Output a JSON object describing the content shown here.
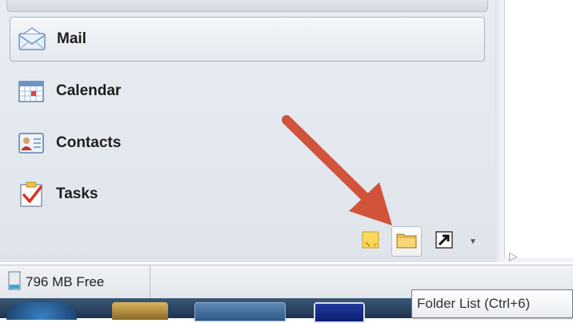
{
  "navigation": {
    "items": [
      {
        "label": "Mail",
        "icon": "mail-icon",
        "selected": true
      },
      {
        "label": "Calendar",
        "icon": "calendar-icon",
        "selected": false
      },
      {
        "label": "Contacts",
        "icon": "contacts-icon",
        "selected": false
      },
      {
        "label": "Tasks",
        "icon": "tasks-icon",
        "selected": false
      }
    ],
    "bottom_buttons": [
      {
        "icon": "notes-icon"
      },
      {
        "icon": "folder-list-icon",
        "hover": true
      },
      {
        "icon": "shortcuts-icon"
      },
      {
        "icon": "configure-buttons-chevron-icon"
      }
    ]
  },
  "status_bar": {
    "free_space": "796 MB Free"
  },
  "tooltip": {
    "text": "Folder List (Ctrl+6)"
  },
  "colors": {
    "annotation_arrow": "#d0533a",
    "nav_background": "#e3e8ee"
  }
}
